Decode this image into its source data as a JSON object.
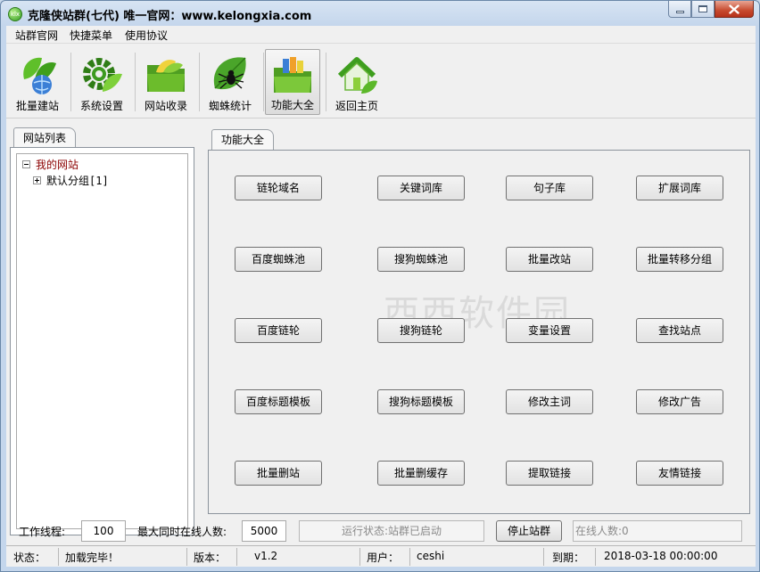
{
  "window": {
    "title": "克隆侠站群(七代)  唯一官网：www.kelongxia.com",
    "app_icon_text": "klx"
  },
  "menu": [
    "站群官网",
    "快捷菜单",
    "使用协议"
  ],
  "toolbar": [
    {
      "label": "批量建站",
      "icon": "leaf-globe-icon"
    },
    {
      "label": "系统设置",
      "icon": "gear-leaf-icon"
    },
    {
      "label": "网站收录",
      "icon": "folder-leaf-icon"
    },
    {
      "label": "蜘蛛统计",
      "icon": "spider-leaf-icon"
    },
    {
      "label": "功能大全",
      "icon": "folder-apps-icon",
      "active": true
    },
    {
      "label": "返回主页",
      "icon": "home-icon"
    }
  ],
  "left_tab": "网站列表",
  "right_tab": "功能大全",
  "tree": {
    "root": "我的网站",
    "child": "默认分组[1]"
  },
  "functions": [
    [
      "链轮域名",
      "关键词库",
      "句子库",
      "扩展词库"
    ],
    [
      "百度蜘蛛池",
      "搜狗蜘蛛池",
      "批量改站",
      "批量转移分组"
    ],
    [
      "百度链轮",
      "搜狗链轮",
      "变量设置",
      "查找站点"
    ],
    [
      "百度标题模板",
      "搜狗标题模板",
      "修改主词",
      "修改广告"
    ],
    [
      "批量删站",
      "批量删缓存",
      "提取链接",
      "友情链接"
    ]
  ],
  "watermark": "西西软件园",
  "controls": {
    "threads_label": "工作线程:",
    "threads_value": "100",
    "max_online_label": "最大同时在线人数:",
    "max_online_value": "5000",
    "run_status": "运行状态:站群已启动",
    "stop_button": "停止站群",
    "online_count": "在线人数:0"
  },
  "statusbar": {
    "status_label": "状态：",
    "status_value": "加载完毕！",
    "version_label": "版本：",
    "version_value": "v1.2",
    "user_label": "用户：",
    "user_value": "ceshi",
    "expire_label": "到期：",
    "expire_value": "2018-03-18 00:00:00"
  },
  "colors": {
    "accent_green": "#3da81f",
    "tree_root": "#8b0000",
    "close_red": "#c74a2e"
  }
}
